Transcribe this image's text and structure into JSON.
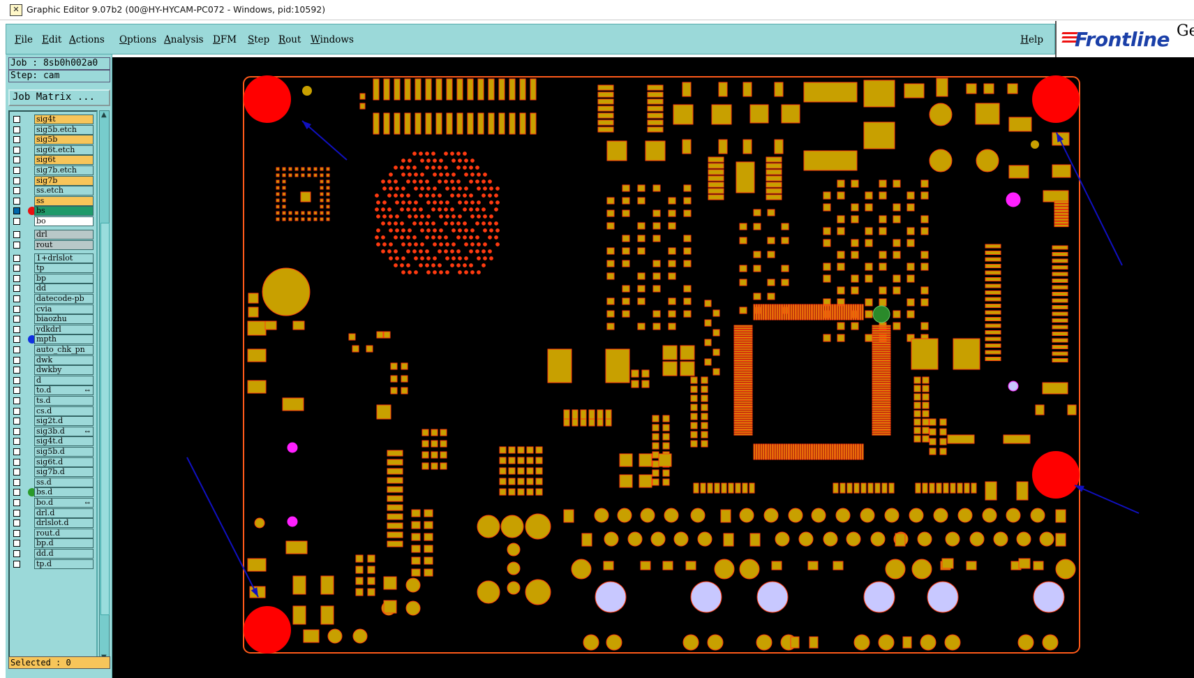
{
  "window": {
    "title": "Graphic Editor 9.07b2 (00@HY-HYCAM-PC072 - Windows, pid:10592)"
  },
  "menu": {
    "items": [
      "File",
      "Edit",
      "Actions",
      "Options",
      "Analysis",
      "DFM",
      "Step",
      "Rout",
      "Windows"
    ],
    "help": "Help"
  },
  "logo": {
    "brand": "Frontline",
    "partial": "Ge"
  },
  "panel": {
    "job": "Job : 8sb0h002a0",
    "step": "Step: cam",
    "job_matrix": "Job Matrix ...",
    "selected": "Selected : 0"
  },
  "layers": [
    {
      "name": "sig4t",
      "style": "yellow"
    },
    {
      "name": "sig5b.etch",
      "style": "cyan"
    },
    {
      "name": "sig5b",
      "style": "yellow"
    },
    {
      "name": "sig6t.etch",
      "style": "cyan"
    },
    {
      "name": "sig6t",
      "style": "yellow"
    },
    {
      "name": "sig7b.etch",
      "style": "cyan"
    },
    {
      "name": "sig7b",
      "style": "yellow"
    },
    {
      "name": "ss.etch",
      "style": "cyan"
    },
    {
      "name": "ss",
      "style": "yellow"
    },
    {
      "name": "bs",
      "style": "green",
      "dot": "#e81010",
      "checked": true
    },
    {
      "name": "bo",
      "style": "white"
    },
    {
      "name": "drl",
      "style": "gray"
    },
    {
      "name": "rout",
      "style": "gray"
    },
    {
      "name": "1+drlslot",
      "style": "cyan"
    },
    {
      "name": "tp",
      "style": "cyan"
    },
    {
      "name": "bp",
      "style": "cyan"
    },
    {
      "name": "dd",
      "style": "cyan"
    },
    {
      "name": "datecode-pb",
      "style": "cyan"
    },
    {
      "name": "cvia",
      "style": "cyan"
    },
    {
      "name": "biaozhu",
      "style": "cyan"
    },
    {
      "name": "ydkdrl",
      "style": "cyan"
    },
    {
      "name": "mpth",
      "style": "cyan",
      "dot": "#1030e0"
    },
    {
      "name": "auto_chk_pn",
      "style": "cyan"
    },
    {
      "name": "dwk",
      "style": "cyan"
    },
    {
      "name": "dwkby",
      "style": "cyan"
    },
    {
      "name": "d",
      "style": "cyan"
    },
    {
      "name": "to.d",
      "style": "cyan",
      "mark": "↔"
    },
    {
      "name": "ts.d",
      "style": "cyan"
    },
    {
      "name": "cs.d",
      "style": "cyan"
    },
    {
      "name": "sig2t.d",
      "style": "cyan"
    },
    {
      "name": "sig3b.d",
      "style": "cyan",
      "mark": "↔"
    },
    {
      "name": "sig4t.d",
      "style": "cyan"
    },
    {
      "name": "sig5b.d",
      "style": "cyan"
    },
    {
      "name": "sig6t.d",
      "style": "cyan"
    },
    {
      "name": "sig7b.d",
      "style": "cyan"
    },
    {
      "name": "ss.d",
      "style": "cyan"
    },
    {
      "name": "bs.d",
      "style": "cyan",
      "dot": "#2a9a2a"
    },
    {
      "name": "bo.d",
      "style": "cyan",
      "mark": "↔"
    },
    {
      "name": "drl.d",
      "style": "cyan"
    },
    {
      "name": "drlslot.d",
      "style": "cyan"
    },
    {
      "name": "rout.d",
      "style": "cyan"
    },
    {
      "name": "bp.d",
      "style": "cyan"
    },
    {
      "name": "dd.d",
      "style": "cyan"
    },
    {
      "name": "tp.d",
      "style": "cyan"
    }
  ],
  "colors": {
    "board_outline": "#ff5a1a",
    "pad": "#c8a000",
    "pad_edge": "#ff3b10",
    "fiducial": "#ff0000",
    "annotation_arrow": "#1010c0",
    "plated_hole": "#c8c8ff",
    "pink_marker": "#ff20ff"
  }
}
